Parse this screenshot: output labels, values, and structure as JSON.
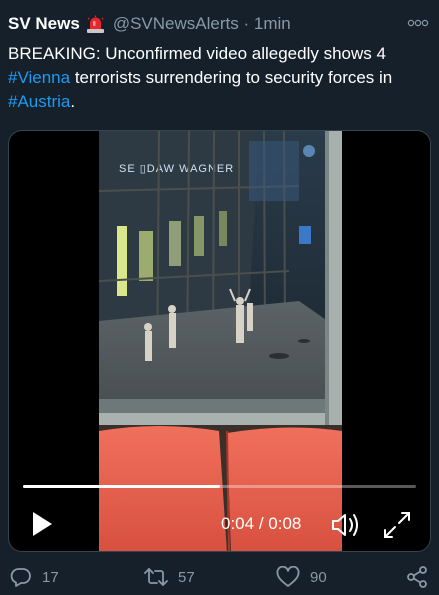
{
  "tweet": {
    "display_name": "SV News",
    "badge_icon": "siren-emoji-icon",
    "handle": "@SVNewsAlerts",
    "separator": "·",
    "time_ago": "1min",
    "text_before": "BREAKING: Unconfirmed video allegedly shows 4 ",
    "hashtag_1": "#Vienna",
    "text_middle": " terrorists surrendering to security forces in ",
    "hashtag_2": "#Austria",
    "text_after": "."
  },
  "video": {
    "sign_text": "SE ▯DAW  WAGNER",
    "current_time": "0:04",
    "time_separator": " / ",
    "duration": "0:08",
    "progress_fraction": 0.5,
    "state": "paused"
  },
  "actions": {
    "replies": "17",
    "retweets": "57",
    "likes": "90"
  },
  "colors": {
    "background": "#15202b",
    "hashtag": "#1d9bf0",
    "muted": "#8899a6"
  }
}
